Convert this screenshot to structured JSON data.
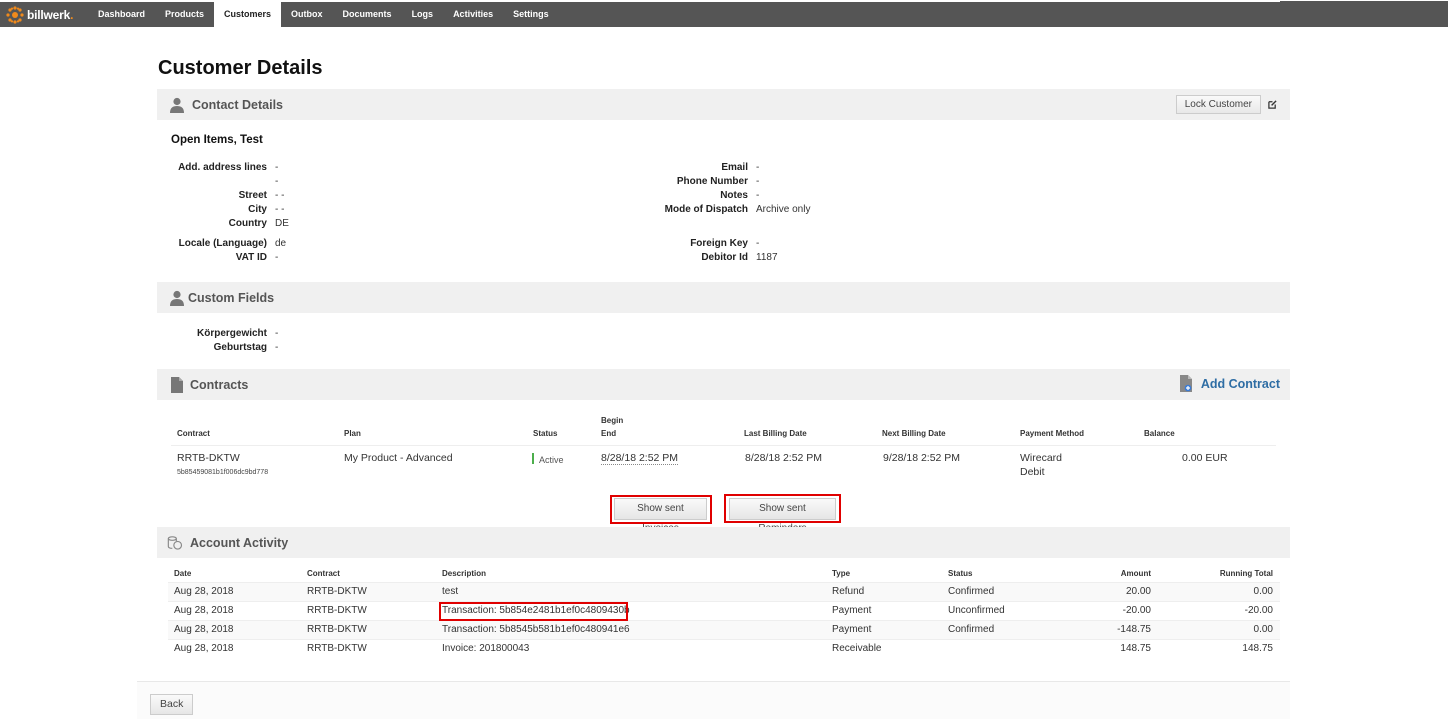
{
  "app": {
    "brand": "billwerk",
    "brand_dot": ".",
    "accent_color": "#f08a1c",
    "nav": [
      {
        "label": "Dashboard",
        "active": false
      },
      {
        "label": "Products",
        "active": false
      },
      {
        "label": "Customers",
        "active": true
      },
      {
        "label": "Outbox",
        "active": false
      },
      {
        "label": "Documents",
        "active": false
      },
      {
        "label": "Logs",
        "active": false
      },
      {
        "label": "Activities",
        "active": false
      },
      {
        "label": "Settings",
        "active": false
      }
    ]
  },
  "page": {
    "title": "Customer Details"
  },
  "contact": {
    "section_title": "Contact Details",
    "lock_button": "Lock Customer",
    "customer_name": "Open Items, Test",
    "left": [
      {
        "label": "Add. address lines",
        "value": "-"
      },
      {
        "label": "",
        "value": "-"
      },
      {
        "label": "Street",
        "value": "- -"
      },
      {
        "label": "City",
        "value": "- -"
      },
      {
        "label": "Country",
        "value": "DE"
      },
      {
        "label": "Locale (Language)",
        "value": "de"
      },
      {
        "label": "VAT ID",
        "value": "-"
      }
    ],
    "right": [
      {
        "label": "Email",
        "value": "-"
      },
      {
        "label": "Phone Number",
        "value": "-"
      },
      {
        "label": "Notes",
        "value": "-"
      },
      {
        "label": "Mode of Dispatch",
        "value": "Archive only"
      },
      {
        "label": "Foreign Key",
        "value": "-"
      },
      {
        "label": "Debitor Id",
        "value": "1187"
      }
    ]
  },
  "custom_fields": {
    "section_title": "Custom Fields",
    "fields": [
      {
        "label": "Körpergewicht",
        "value": "-"
      },
      {
        "label": "Geburtstag",
        "value": "-"
      }
    ]
  },
  "contracts": {
    "section_title": "Contracts",
    "add_label": "Add Contract",
    "headers": {
      "contract": "Contract",
      "plan": "Plan",
      "status": "Status",
      "begin": "Begin",
      "end": "End",
      "last_billing": "Last Billing Date",
      "next_billing": "Next Billing Date",
      "payment_method": "Payment Method",
      "balance": "Balance"
    },
    "rows": [
      {
        "contract": "RRTB-DKTW",
        "contract_id": "5b85459081b1f006dc9bd778",
        "plan": "My Product - Advanced",
        "status": "Active",
        "status_color": "#4cae4c",
        "begin_end": "8/28/18 2:52 PM",
        "last_billing": "8/28/18 2:52 PM",
        "next_billing": "9/28/18 2:52 PM",
        "payment_method_1": "Wirecard",
        "payment_method_2": "Debit",
        "balance": "0.00 EUR"
      }
    ],
    "show_invoices": "Show sent Invoices",
    "show_reminders": "Show sent Reminders"
  },
  "activity": {
    "section_title": "Account Activity",
    "headers": {
      "date": "Date",
      "contract": "Contract",
      "description": "Description",
      "type": "Type",
      "status": "Status",
      "amount": "Amount",
      "running_total": "Running Total"
    },
    "rows": [
      {
        "date": "Aug 28, 2018",
        "contract": "RRTB-DKTW",
        "description": "test",
        "is_link": false,
        "type": "Refund",
        "status": "Confirmed",
        "amount": "20.00",
        "running_total": "0.00"
      },
      {
        "date": "Aug 28, 2018",
        "contract": "RRTB-DKTW",
        "description": "Transaction: 5b854e2481b1ef0c4809430b",
        "is_link": true,
        "type": "Payment",
        "status": "Unconfirmed",
        "amount": "-20.00",
        "running_total": "-20.00"
      },
      {
        "date": "Aug 28, 2018",
        "contract": "RRTB-DKTW",
        "description": "Transaction: 5b8545b581b1ef0c480941e6",
        "is_link": true,
        "type": "Payment",
        "status": "Confirmed",
        "amount": "-148.75",
        "running_total": "0.00"
      },
      {
        "date": "Aug 28, 2018",
        "contract": "RRTB-DKTW",
        "description": "Invoice: 201800043",
        "is_link": true,
        "type": "Receivable",
        "status": "",
        "amount": "148.75",
        "running_total": "148.75"
      }
    ]
  },
  "footer": {
    "back_label": "Back"
  },
  "highlight_color": "#e00000"
}
